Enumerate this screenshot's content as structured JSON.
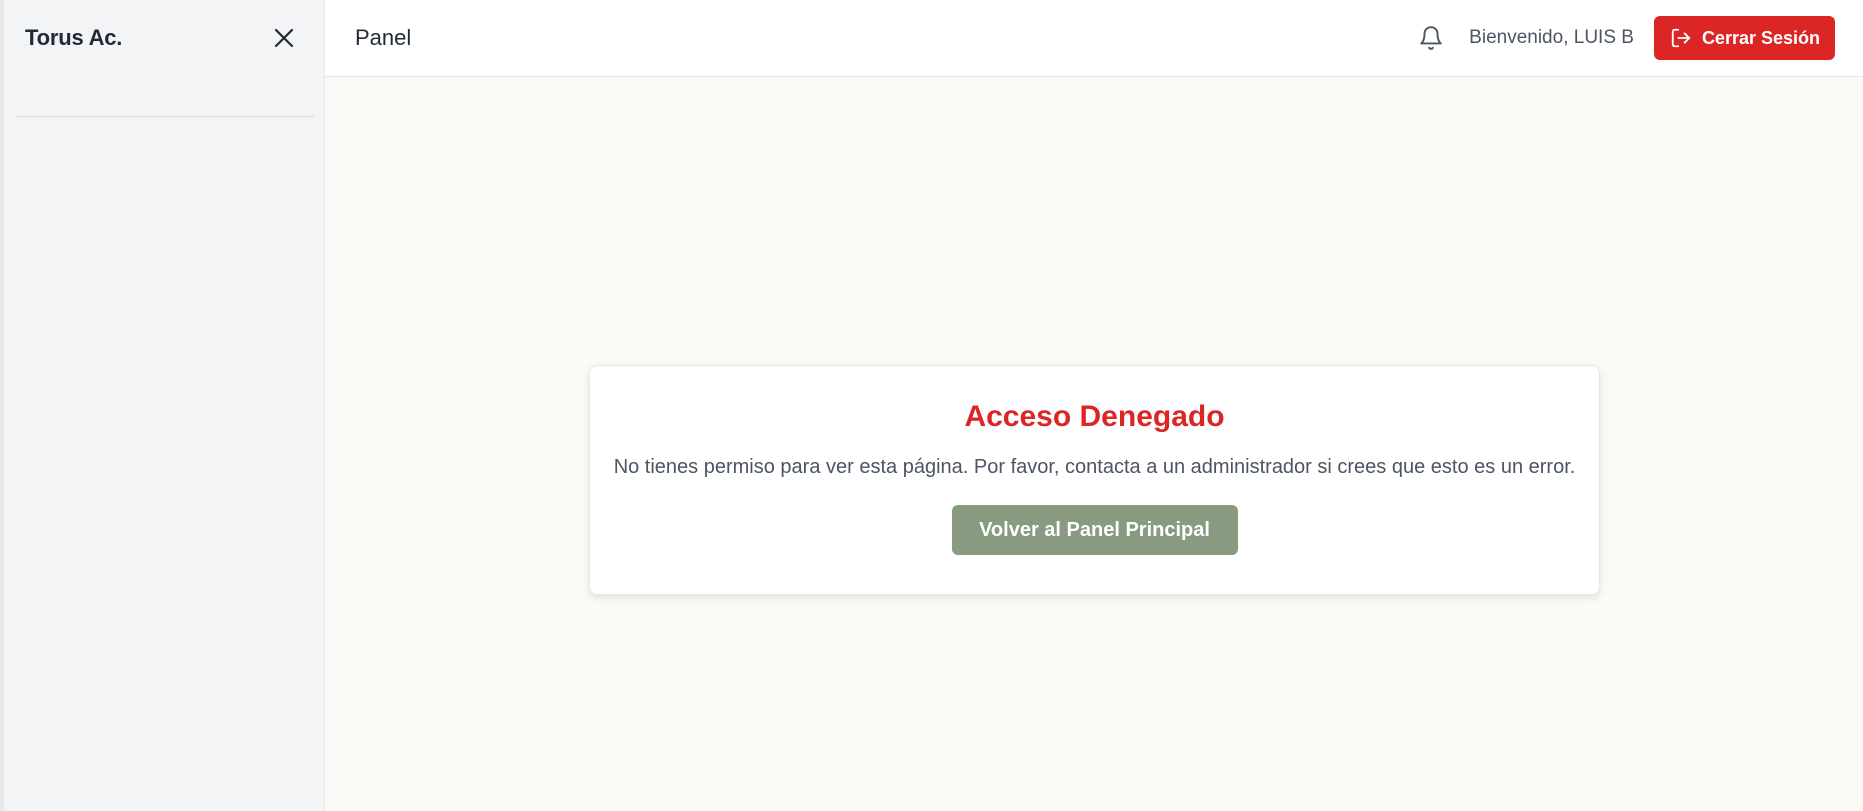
{
  "sidebar": {
    "brand": "Torus Ac.",
    "close_icon": "close-icon"
  },
  "header": {
    "title": "Panel",
    "bell_icon": "bell-icon",
    "welcome": "Bienvenido, LUIS B",
    "logout_label": "Cerrar Sesión",
    "logout_icon": "logout-icon"
  },
  "card": {
    "title": "Acceso Denegado",
    "message": "No tienes permiso para ver esta página. Por favor, contacta a un administrador si crees que esto es un error.",
    "button_label": "Volver al Panel Principal"
  },
  "colors": {
    "danger": "#dc2626",
    "sage": "#889b80",
    "sidebar_bg": "#f3f4f6",
    "content_bg": "#fbfaf7"
  }
}
